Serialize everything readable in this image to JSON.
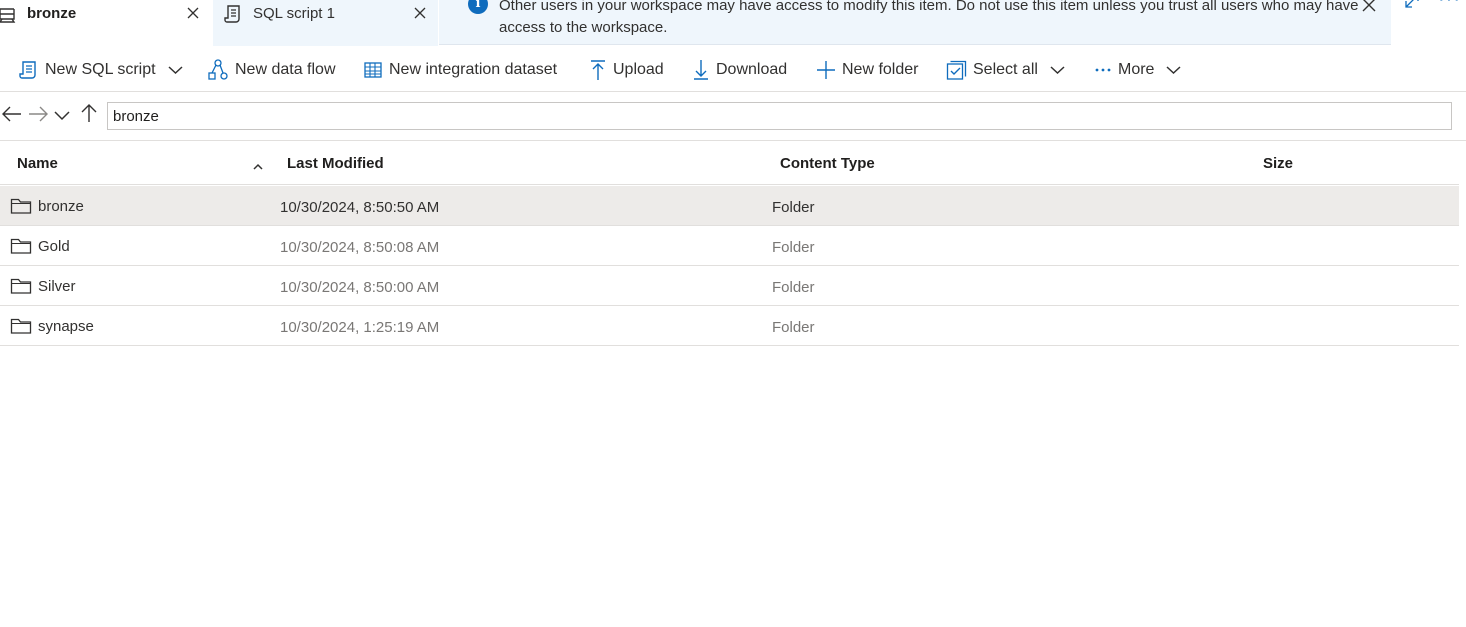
{
  "tabs": [
    {
      "label": "bronze",
      "active": true
    },
    {
      "label": "SQL script 1",
      "active": false
    }
  ],
  "notice": {
    "text": "Other users in your workspace may have access to modify this item. Do not use this item unless you trust all users who may have access to the workspace."
  },
  "toolbar": {
    "new_sql_script": "New SQL script",
    "new_data_flow": "New data flow",
    "new_integration_dataset": "New integration dataset",
    "upload": "Upload",
    "download": "Download",
    "new_folder": "New folder",
    "select_all": "Select all",
    "more": "More"
  },
  "path": {
    "value": "bronze"
  },
  "table": {
    "headers": {
      "name": "Name",
      "last_modified": "Last Modified",
      "content_type": "Content Type",
      "size": "Size"
    },
    "sort": {
      "column": "name",
      "direction": "ascending"
    },
    "rows": [
      {
        "name": "bronze",
        "last_modified": "10/30/2024, 8:50:50 AM",
        "content_type": "Folder",
        "size": "",
        "selected": true
      },
      {
        "name": "Gold",
        "last_modified": "10/30/2024, 8:50:08 AM",
        "content_type": "Folder",
        "size": "",
        "selected": false
      },
      {
        "name": "Silver",
        "last_modified": "10/30/2024, 8:50:00 AM",
        "content_type": "Folder",
        "size": "",
        "selected": false
      },
      {
        "name": "synapse",
        "last_modified": "10/30/2024, 1:25:19 AM",
        "content_type": "Folder",
        "size": "",
        "selected": false
      }
    ]
  },
  "icons": {
    "tab_bronze": "database-icon",
    "tab_sql": "script-icon",
    "notice": "info-icon",
    "folder": "folder-icon"
  },
  "colors": {
    "accent": "#0f6cbd",
    "notice_bg": "#eff6fc",
    "selected_row": "#edebe9",
    "text": "#323130",
    "secondary_text": "#797775"
  }
}
